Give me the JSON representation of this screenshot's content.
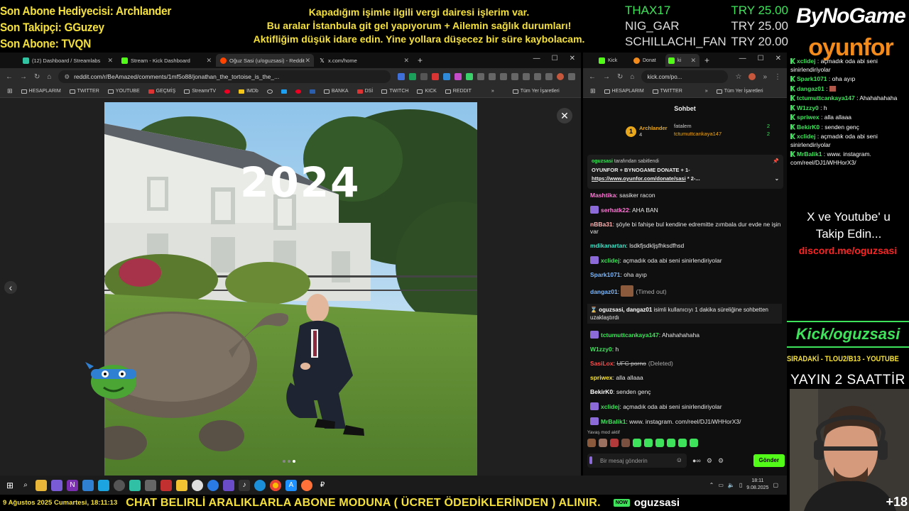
{
  "overlay": {
    "left_lines": [
      "Son Abone Hediyecisi: Archlander",
      "Son Takipçi: GGuzey",
      "Son Abone: TVQN"
    ],
    "center_lines": [
      "Kapadığım işimle ilgili vergi dairesi işlerim var.",
      "Bu aralar İstanbula git gel yapıyorum + Ailemin sağlık durumları!",
      "Aktifliğim düşük idare edin. Yine yollara düşecez bir süre kaybolacam."
    ],
    "donations": [
      {
        "name": "THAX17",
        "amount": "TRY 25.00"
      },
      {
        "name": "NIG_GAR",
        "amount": "TRY 25.00"
      },
      {
        "name": "SCHILLACHI_FAN",
        "amount": "TRY 20.00"
      }
    ],
    "logo_top": "ByNoGame",
    "logo_bottom": "oyunfor"
  },
  "browser1": {
    "tabs": [
      {
        "label": "(12) Dashboard / Streamlabs",
        "color": "#31c3a2"
      },
      {
        "label": "Stream - Kick Dashboard",
        "color": "#53fc18"
      },
      {
        "label": "Oğuz Sasi (u/oguzsasi) - Reddit",
        "color": "#ff4500"
      },
      {
        "label": "x.com/home",
        "color": "#ffffff"
      }
    ],
    "new_tab": "+",
    "url": "reddit.com/r/BeAmazed/comments/1mf5o88/jonathan_the_tortoise_is_the_...",
    "bookmarks": [
      "HESAPLARIM",
      "TWITTER",
      "YOUTUBE",
      "GEÇMİŞ",
      "StreamrTV",
      "IMDb",
      "BANKA",
      "DSİ",
      "TWITCH",
      "KICK",
      "REDDIT"
    ],
    "bookmarks_overflow": "»",
    "all_bookmarks": "Tüm Yer İşaretleri",
    "image_text": "2024",
    "close": "✕",
    "prev": "‹"
  },
  "browser2": {
    "tabs": [
      {
        "label": "Kick",
        "color": "#53fc18"
      },
      {
        "label": "Donat",
        "color": "#f28a1c"
      },
      {
        "label": "ki",
        "color": "#53fc18"
      }
    ],
    "url": "kick.com/po...",
    "bookmarks": [
      "HESAPLARIM",
      "TWITTER"
    ],
    "all_bookmarks": "Tüm Yer İşaretleri",
    "chat_title": "Sohbet",
    "top_gifters": {
      "first": {
        "rank": "1",
        "name": "Archlander",
        "count": "4"
      },
      "others": [
        {
          "name": "fatalem",
          "count": "2"
        },
        {
          "name": "tctumuttcankaya147",
          "count": "2"
        }
      ]
    },
    "pinned": {
      "header_user": "oguzsasi",
      "header_suffix": "tarafından sabitlendi",
      "text": "OYUNFOR + BYNOGAME DONATE + 1-",
      "link": "https://www.oyunfor.com/donate/sasi",
      "link_suffix": " * 2-..."
    },
    "messages": [
      {
        "user": "Mashtika",
        "color": "#ff77d6",
        "text": "sasiker racon",
        "icon": false
      },
      {
        "user": "serhatk22",
        "color": "#ff77d6",
        "text": "AHA BAN",
        "icon": true
      },
      {
        "user": "nBBa31",
        "color": "#ffb0b0",
        "text": "şöyle bi fahişe bul kendine edremitte zımbala dur evde ne işin var",
        "icon": false
      },
      {
        "user": "mdikanartan",
        "color": "#3ee3c7",
        "text": "lsdkfjsdkljşfhksdfhsd",
        "icon": false
      },
      {
        "user": "xclidej",
        "color": "#3ee35b",
        "text": "açmadık oda abi seni sinirlendiriyolar",
        "icon": true
      },
      {
        "user": "Spark1071",
        "color": "#7ab8ff",
        "text": "oha ayıp",
        "icon": false
      },
      {
        "user": "dangaz01",
        "color": "#7ab8ff",
        "text": "(Timed out)",
        "icon": false,
        "emote": true,
        "timed": true
      }
    ],
    "system_message": {
      "users": "oguzsasi, dangaz01",
      "text": " isimli kullanıcıyı 1 dakika süreliğine sohbetten uzaklaştırdı"
    },
    "messages2": [
      {
        "user": "tctumuttcankaya147",
        "color": "#3ee35b",
        "text": "Ahahahahaha",
        "icon": true
      },
      {
        "user": "W1zzy0",
        "color": "#3ee35b",
        "text": "h",
        "icon": false
      },
      {
        "user": "SasiLox",
        "color": "#ff4b4b",
        "text": "UFC porno",
        "icon": false,
        "deleted": "(Deleted)"
      },
      {
        "user": "spriwex",
        "color": "#f5e13a",
        "text": "alla allaaa",
        "icon": false
      },
      {
        "user": "BekirK0",
        "color": "#ffffff",
        "text": "senden genç",
        "icon": false
      },
      {
        "user": "xclidej",
        "color": "#3ee35b",
        "text": "açmadık oda abi seni sinirlendiriyolar",
        "icon": true
      },
      {
        "user": "MrBalik1",
        "color": "#3ee35b",
        "text": "www. instagram. com/reel/DJ1iWHHorX3/",
        "icon": true
      }
    ],
    "slow_mode": "Yavaş mod aktif",
    "input_placeholder": "Bir mesaj gönderin",
    "send": "Gönder"
  },
  "right_chat": [
    {
      "user": "xclidej",
      "text": "açmadık oda abi seni sinirlendiriyolar"
    },
    {
      "user": "Spark1071",
      "text": "oha ayıp"
    },
    {
      "user": "dangaz01",
      "text": ""
    },
    {
      "user": "tctumuttcankaya147",
      "text": "Ahahahahaha"
    },
    {
      "user": "W1zzy0",
      "text": "h"
    },
    {
      "user": "spriwex",
      "text": "alla allaaa"
    },
    {
      "user": "BekirK0",
      "text": "senden genç"
    },
    {
      "user": "xclidej",
      "text": "açmadık oda abi seni sinirlendiriyolar"
    },
    {
      "user": "MrBalik1",
      "text": "www. instagram. com/reel/DJ1iWHHorX3/"
    }
  ],
  "right_overlay": {
    "follow_line1": "X ve Youtube' u",
    "follow_line2": "Takip Edin...",
    "discord": "discord.me/oguzsasi",
    "kick": "Kick/oguzsasi",
    "next": "SIRADAKİ - TLOU2/B13 - YOUTUBE",
    "duration": "YAYIN 2 SAATTİR",
    "age": "+18"
  },
  "taskbar": {
    "time": "18:11",
    "date": "9.08.2025"
  },
  "bottom": {
    "date": "9 Ağustos 2025 Cumartesi, 18:11:13",
    "ticker": "CHAT BELIRLİ ARALIKLARLA ABONE MODUNA ( ÜCRET ÖDEDİKLERİNDEN ) ALINIR.",
    "kick_badge": "NOW",
    "channel": "oguzsasi"
  }
}
